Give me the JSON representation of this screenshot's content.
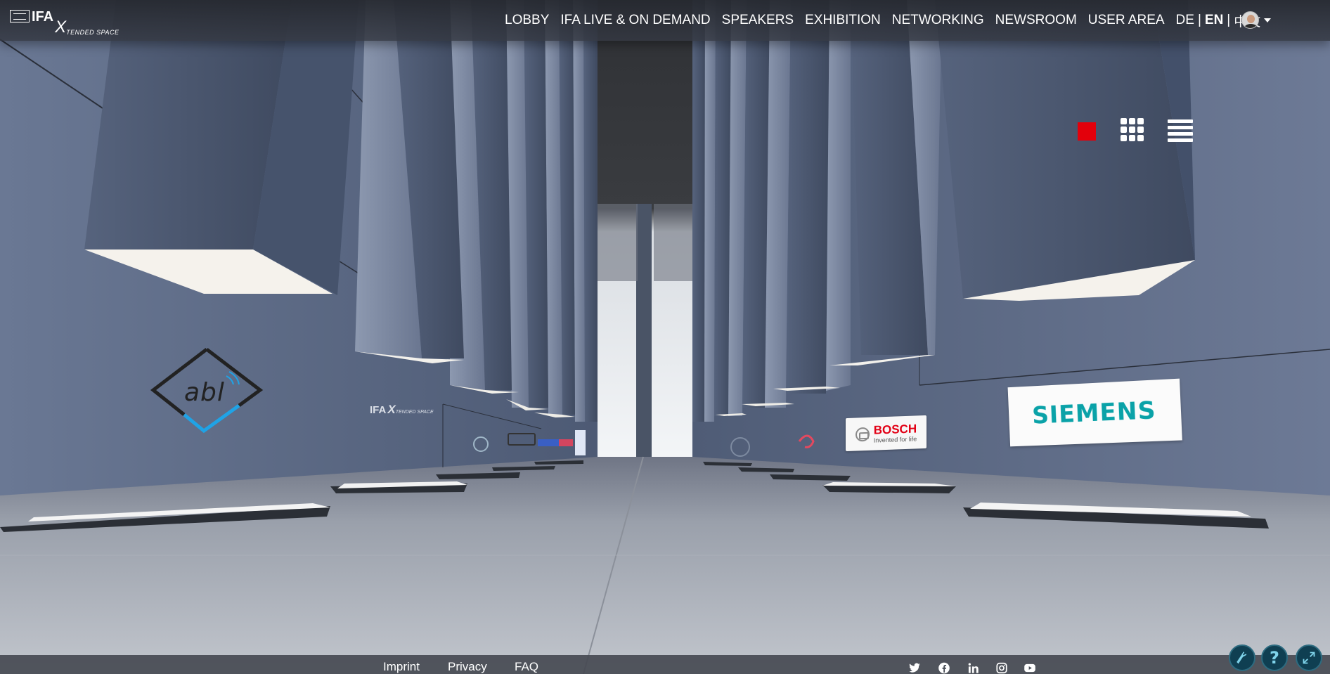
{
  "brand": {
    "name": "IFA",
    "x": "X",
    "subtitle": "TENDED SPACE"
  },
  "nav": {
    "items": [
      "LOBBY",
      "IFA LIVE & ON DEMAND",
      "SPEAKERS",
      "EXHIBITION",
      "NETWORKING",
      "NEWSROOM",
      "USER AREA"
    ],
    "languages": {
      "de": "DE",
      "en": "EN",
      "zh": "中文",
      "separator": "|",
      "active": "EN"
    }
  },
  "view_switch": {
    "modes": [
      "3d-view",
      "grid-view",
      "list-view"
    ],
    "active": "3d-view",
    "active_color": "#e3000b"
  },
  "exhibitors": {
    "abl": "abl",
    "bosch": {
      "name": "BOSCH",
      "tagline": "Invented for life"
    },
    "siemens": "SIEMENS",
    "wall_sign": {
      "name": "IFA",
      "x": "X",
      "subtitle": "TENDED SPACE"
    }
  },
  "footer": {
    "links": [
      "Imprint",
      "Privacy",
      "FAQ"
    ],
    "social": [
      "twitter-icon",
      "facebook-icon",
      "linkedin-icon",
      "instagram-icon",
      "youtube-icon"
    ]
  },
  "floating_buttons": [
    "tools-icon",
    "help-icon",
    "fullscreen-icon"
  ],
  "colors": {
    "accent_red": "#e3000b",
    "bosch_red": "#e20015",
    "siemens_teal": "#0aa2a8",
    "abl_blue": "#1fa3e6",
    "button_teal": "#0f3f52"
  }
}
